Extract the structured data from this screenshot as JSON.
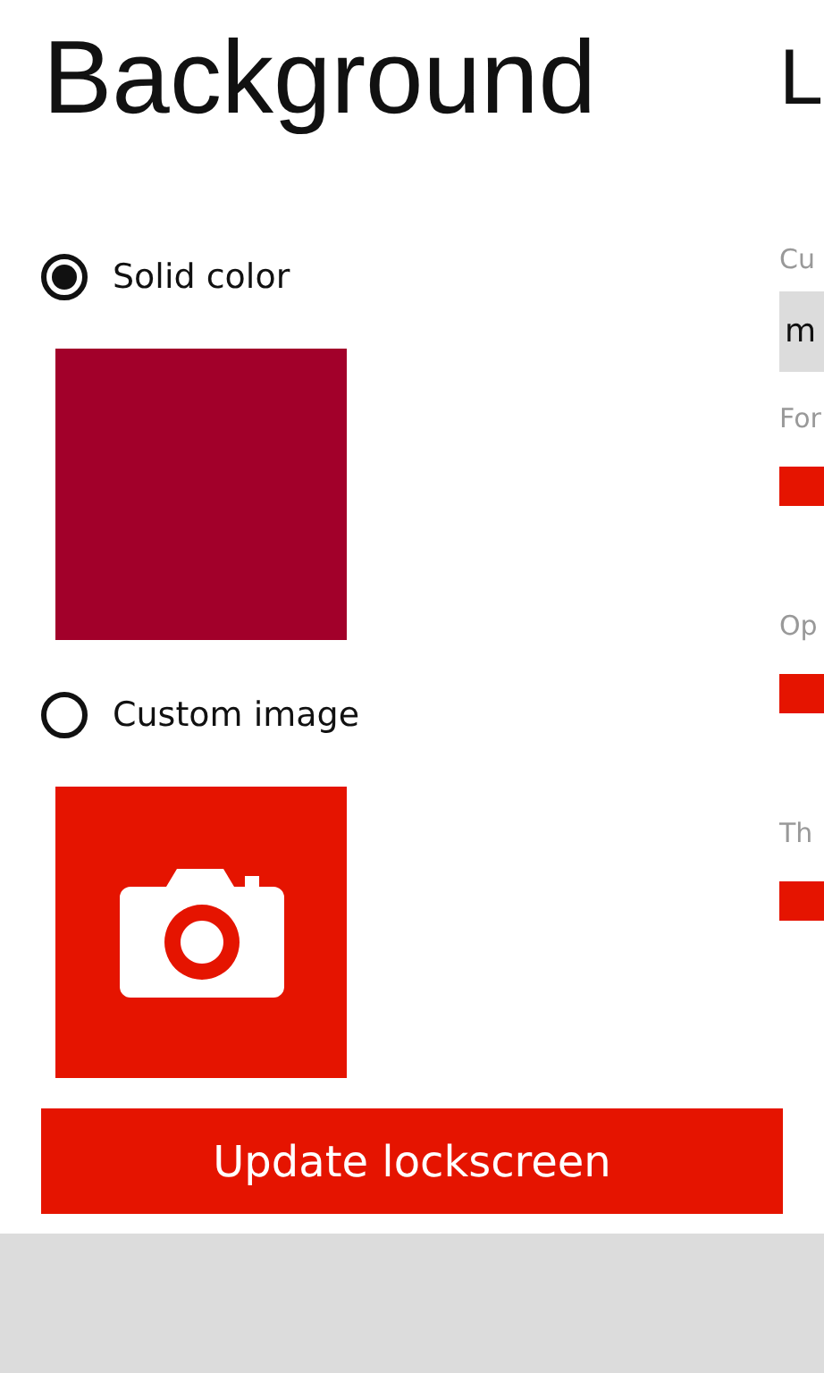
{
  "background": {
    "title": "Background",
    "options": [
      {
        "label": "Solid color",
        "selected": true,
        "kind": "color",
        "color": "#a2002a"
      },
      {
        "label": "Custom image",
        "selected": false,
        "kind": "image"
      }
    ],
    "button": "Update lockscreen"
  },
  "side_panel": {
    "title": "L",
    "field_label": "Cu",
    "field_value": "m",
    "settings": [
      {
        "label": "For",
        "color": "#e51400"
      },
      {
        "label": "Op",
        "color": "#e51400"
      },
      {
        "label": "Th",
        "color": "#e51400"
      }
    ]
  }
}
